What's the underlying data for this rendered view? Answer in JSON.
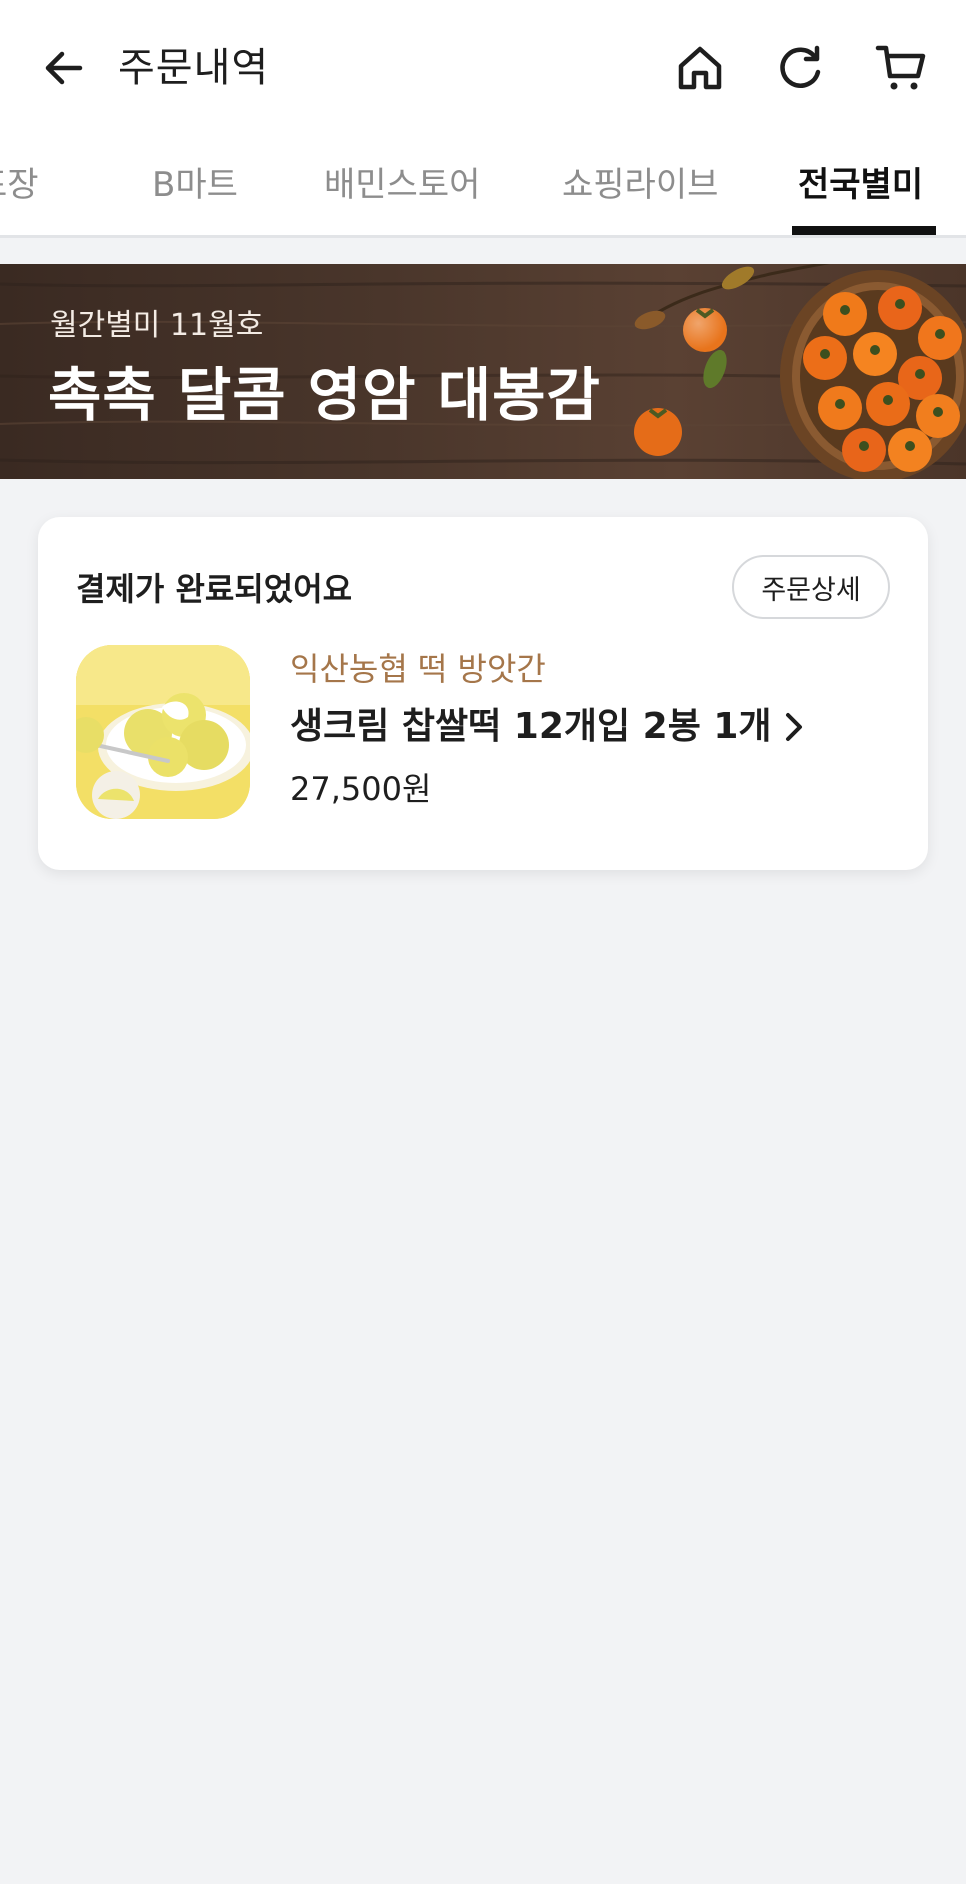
{
  "header": {
    "title": "주문내역",
    "back_icon": "arrow-left-icon",
    "home_icon": "home-icon",
    "refresh_icon": "refresh-icon",
    "cart_icon": "cart-icon"
  },
  "tabs": [
    {
      "label": "포장",
      "active": false
    },
    {
      "label": "B마트",
      "active": false
    },
    {
      "label": "배민스토어",
      "active": false
    },
    {
      "label": "쇼핑라이브",
      "active": false
    },
    {
      "label": "전국별미",
      "active": true
    }
  ],
  "banner": {
    "subtitle": "월간별미 11월호",
    "title": "촉촉 달콤 영암 대봉감"
  },
  "order": {
    "status": "결제가 완료되었어요",
    "detail_button": "주문상세",
    "store": "익산농협 떡 방앗간",
    "product_name": "생크림 찹쌀떡 12개입 2봉 1개",
    "price": "27,500원"
  },
  "colors": {
    "background": "#f2f3f5",
    "card": "#ffffff",
    "store_text": "#a5764a",
    "active_tab": "#111111",
    "inactive_tab": "#8d8d8d"
  }
}
